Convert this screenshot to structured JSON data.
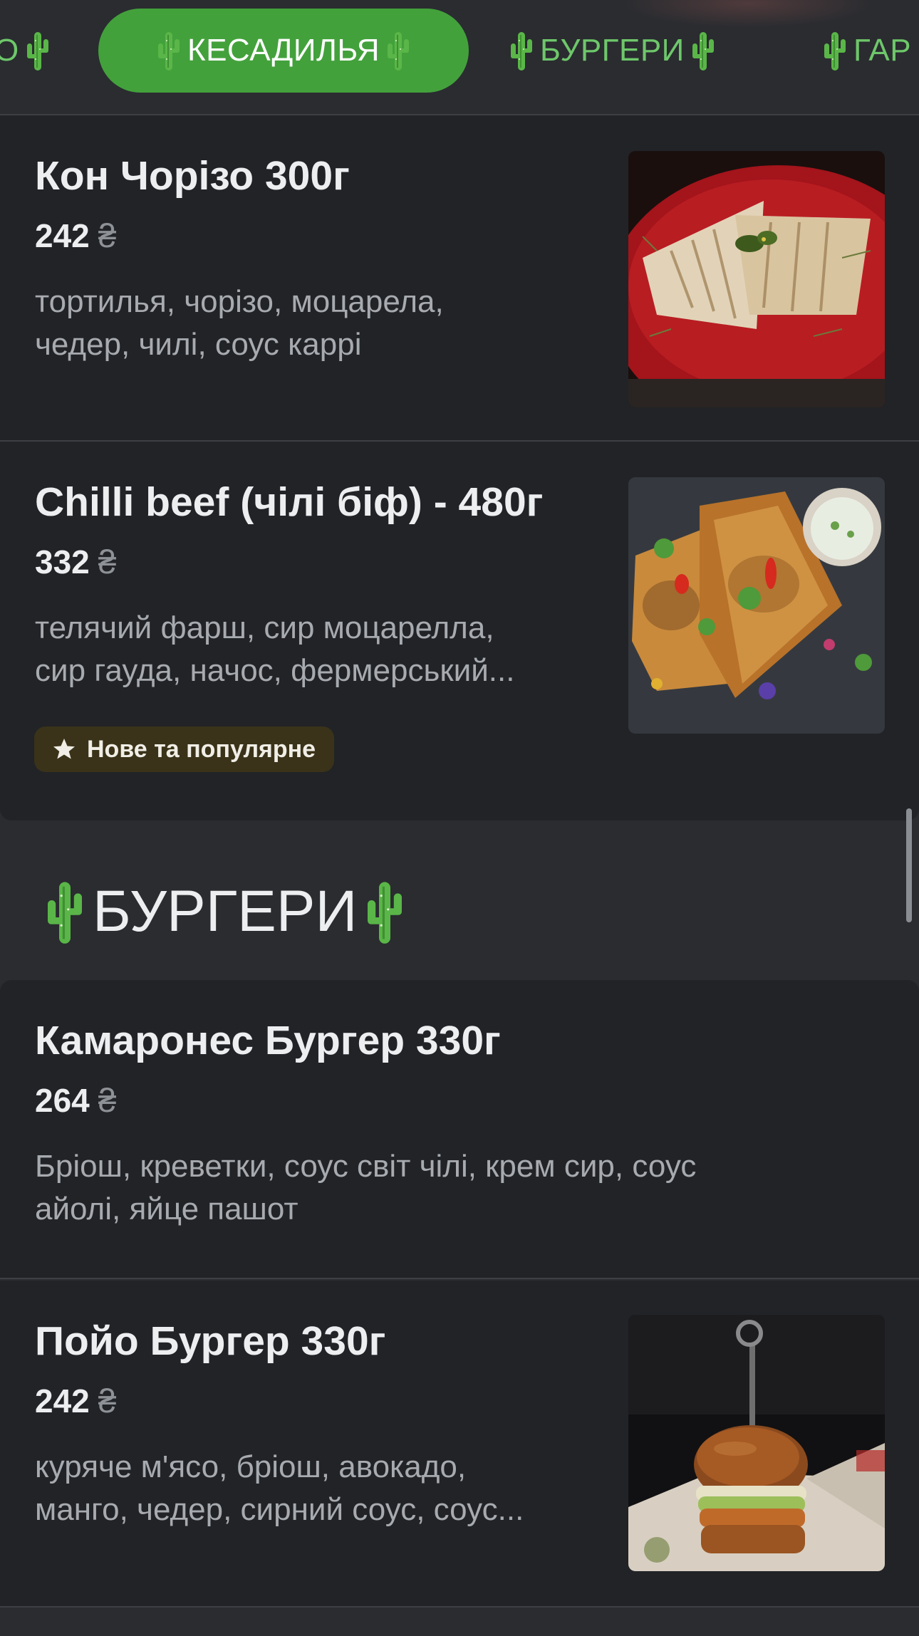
{
  "tabs": [
    {
      "label": "О",
      "active": false
    },
    {
      "label": "КЕСАДИЛЬЯ",
      "active": true
    },
    {
      "label": "БУРГЕРИ",
      "active": false
    },
    {
      "label": "ГАР",
      "active": false
    }
  ],
  "currency": "₴",
  "items_quesadilla": [
    {
      "title": "Кон Чорізо 300г",
      "price": "242",
      "desc_line1": "тортилья, чорізо, моцарела,",
      "desc_line2": "чедер, чилі, соус каррі",
      "image": "quesadilla-photo"
    },
    {
      "title": "Chilli beef (чілі біф) - 480г",
      "price": "332",
      "desc_line1": "телячий фарш, сир моцарелла,",
      "desc_line2": "сир гауда, начос, фермерський...",
      "badge": "Нове та популярне",
      "image": "quesadilla-photo"
    }
  ],
  "section_burgers": {
    "title": "БУРГЕРИ"
  },
  "items_burgers": [
    {
      "title": "Камаронес Бургер 330г",
      "price": "264",
      "desc_line1": "Бріош, креветки, соус світ чілі, крем сир, соус",
      "desc_line2": "айолі, яйце пашот"
    },
    {
      "title": "Пойо Бургер 330г",
      "price": "242",
      "desc_line1": "куряче м'ясо, бріош, авокадо,",
      "desc_line2": "манго, чедер, сирний соус, соус...",
      "image": "burger-photo"
    }
  ],
  "colors": {
    "accent": "#43a13c",
    "tab_text": "#6ec76a",
    "background": "#2a2c30",
    "card": "#212327",
    "badge_bg": "#3a3319"
  }
}
